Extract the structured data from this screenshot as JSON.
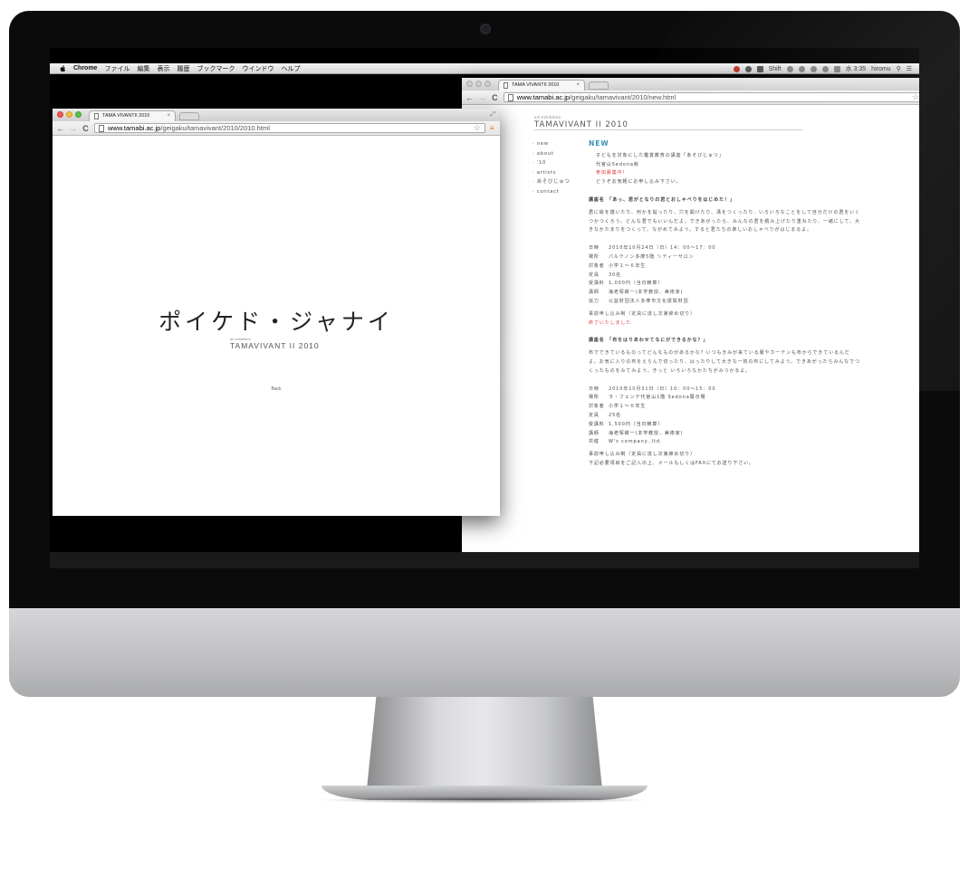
{
  "menubar": {
    "app": "Chrome",
    "items": [
      "ファイル",
      "編集",
      "表示",
      "履歴",
      "ブックマーク",
      "ウインドウ",
      "ヘルプ"
    ],
    "shift_label": "Shift",
    "clock": "水 3:35",
    "user": "hiromu"
  },
  "window_new": {
    "tab_title": "TAMA VIVANTII 2010",
    "url_host": "www.tamabi.ac.jp",
    "url_path": "/geigaku/tamavivant/2010/new.html",
    "brand_small": "art exhibition",
    "brand_big": "TAMAVIVANT II 2010",
    "nav": [
      "· new",
      "· about",
      "· '10",
      "· artists",
      "· あそびじゅつ",
      "· contact"
    ],
    "heading": "NEW",
    "intro": [
      "子どもを対象にした鑑賞教育の講座「あそびじゅつ」",
      "代官山Sedona館"
    ],
    "intro_red": "参加募集中！",
    "intro_end": "どうぞお気軽にお申し込み下さい。",
    "course1_title": "講座名 「あっ、君がとなりの君とおしゃべりをはじめた！」",
    "course1_desc": "君に絵を描いたり、何かを貼ったり、穴を開けたり、溝をつくったり、いろいろなことをして自分だけの君をいくつかつくろう。どんな君でもいいんだよ。できあがったら、みんなの君を積み上げたり重ねたり、一緒にして、大きなかたまりをつくって、ながめてみよう。すると君たちの楽しいおしゃべりがはじまるよ。",
    "course1_details": [
      {
        "k": "日時",
        "v": "2010年10月24日（日）14：00〜17：00"
      },
      {
        "k": "場所",
        "v": "パルテノン多摩5階 シティーサロン"
      },
      {
        "k": "対象者",
        "v": "小学１〜６年生"
      },
      {
        "k": "定員",
        "v": "30名"
      },
      {
        "k": "受講料",
        "v": "1,000円（当日精算）"
      },
      {
        "k": "講師",
        "v": "海老塚耕一(本学教授、美術家)"
      },
      {
        "k": "協力",
        "v": "公益財団法人多摩市文化振興財団"
      }
    ],
    "course1_note": "事前申し込み制（定員に達し次第締め切り）",
    "course1_closed": "終了いたしました",
    "course2_title": "講座名 「布をはりあわせてなにができるかな？」",
    "course2_desc": "布でできているものってどんなものがあるかな？いつもきみが来ている服やカーテンも布からできているんだよ。お気に入りの布をえらんで切ったり、はったりして大きな一枚の布にしてみよう。できあがったらみんなでつくったものをみてみよう。きっと いろいろなかたちがみつかるよ。",
    "course2_details": [
      {
        "k": "日時",
        "v": "2010年10月31日（日）10：00〜15：00"
      },
      {
        "k": "場所",
        "v": "ラ・フェンテ代官山1階 Sedona展示場"
      },
      {
        "k": "対象者",
        "v": "小学１〜６年生"
      },
      {
        "k": "定員",
        "v": "25名"
      },
      {
        "k": "受講料",
        "v": "1,500円（当日精算）"
      },
      {
        "k": "講師",
        "v": "海老塚耕一(本学教授、美術家)"
      },
      {
        "k": "共催",
        "v": "W's company.,ltd."
      }
    ],
    "course2_note1": "事前申し込み制（定員に達し次第締め切り）",
    "course2_note2": "下記必要項目をご記入の上、メールもしくはFAXにてお送り下さい。"
  },
  "window_2010": {
    "tab_title": "TAMA VIVANTII 2010",
    "url_host": "www.tamabi.ac.jp",
    "url_path": "/geigaku/tamavivant/2010/2010.html",
    "title": "ポイケド・ジャナイ",
    "brand_small": "art exhibition",
    "brand_big": "TAMAVIVANT II 2010",
    "back": "Back"
  },
  "colors": {
    "accent_new": "#3a8fb7",
    "red": "#e0323a",
    "light_red": "#ee5c54",
    "light_yellow": "#f4bd3d",
    "light_green": "#5dc04a"
  }
}
